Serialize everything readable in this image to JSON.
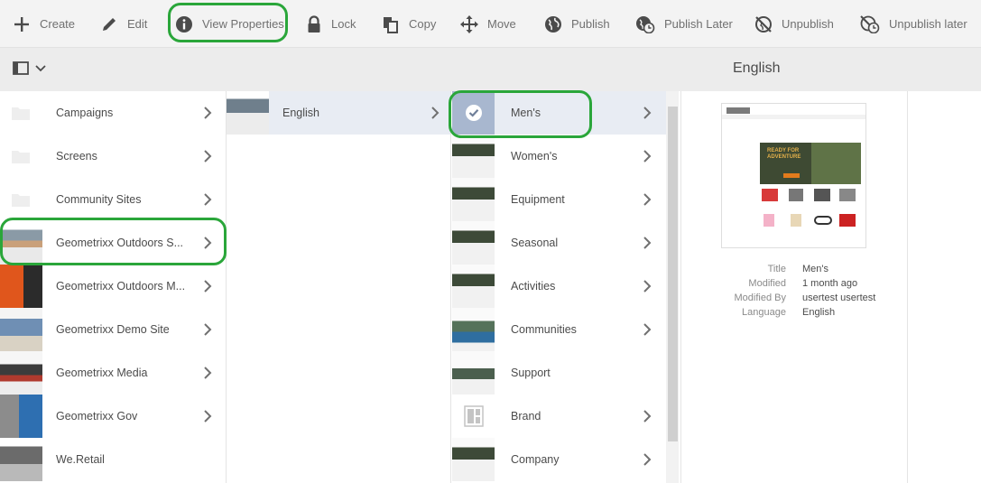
{
  "toolbar": {
    "create": "Create",
    "edit": "Edit",
    "view_properties": "View Properties",
    "lock": "Lock",
    "copy": "Copy",
    "move": "Move",
    "publish": "Publish",
    "publish_later": "Publish Later",
    "unpublish": "Unpublish",
    "unpublish_later": "Unpublish later"
  },
  "detail": {
    "title": "English",
    "properties": [
      {
        "label": "Title",
        "value": "Men's"
      },
      {
        "label": "Modified",
        "value": "1 month ago"
      },
      {
        "label": "Modified By",
        "value": "usertest usertest"
      },
      {
        "label": "Language",
        "value": "English"
      }
    ]
  },
  "column1": [
    {
      "label": "Campaigns",
      "thumb": "folder-icon"
    },
    {
      "label": "Screens",
      "thumb": "folder-icon"
    },
    {
      "label": "Community Sites",
      "thumb": "folder-icon"
    },
    {
      "label": "Geometrixx Outdoors S...",
      "thumb": "page"
    },
    {
      "label": "Geometrixx Outdoors M...",
      "thumb": "page"
    },
    {
      "label": "Geometrixx Demo Site",
      "thumb": "page"
    },
    {
      "label": "Geometrixx Media",
      "thumb": "page"
    },
    {
      "label": "Geometrixx Gov",
      "thumb": "page"
    },
    {
      "label": "We.Retail",
      "thumb": "page"
    }
  ],
  "column2": [
    {
      "label": "English"
    }
  ],
  "column3": [
    {
      "label": "Men's"
    },
    {
      "label": "Women's"
    },
    {
      "label": "Equipment"
    },
    {
      "label": "Seasonal"
    },
    {
      "label": "Activities"
    },
    {
      "label": "Communities"
    },
    {
      "label": "Support"
    },
    {
      "label": "Brand"
    },
    {
      "label": "Company"
    }
  ],
  "preview": {
    "headline": "READY FOR ADVENTURE"
  },
  "colors": {
    "highlight": "#2aa63a",
    "selected_row": "#e8ecf3",
    "toolbar_bg": "#f3f3f3"
  }
}
